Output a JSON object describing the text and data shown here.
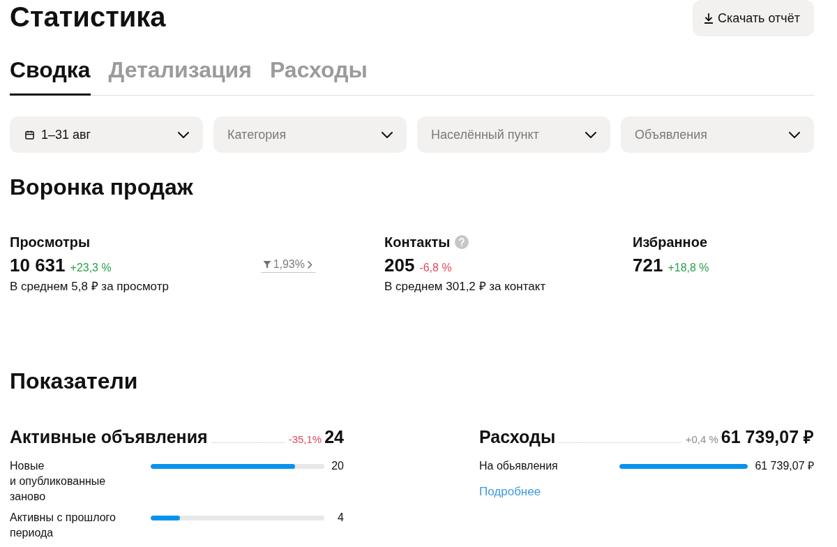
{
  "page": {
    "title": "Статистика",
    "download_button": "Скачать отчёт"
  },
  "tabs": [
    {
      "label": "Сводка",
      "selected": true
    },
    {
      "label": "Детализация",
      "selected": false
    },
    {
      "label": "Расходы",
      "selected": false
    }
  ],
  "filters": [
    {
      "kind": "date",
      "value": "1–31 авг"
    },
    {
      "kind": "select",
      "placeholder": "Категория"
    },
    {
      "kind": "select",
      "placeholder": "Населённый пункт"
    },
    {
      "kind": "select",
      "placeholder": "Объявления"
    }
  ],
  "sales_funnel": {
    "title": "Воронка продаж",
    "metrics": [
      {
        "label": "Просмотры",
        "value": "10 631",
        "change": "+23,3 %",
        "color": "#26a348",
        "conversion": "1,93%",
        "note": "В среднем 5,8 ₽ за просмотр"
      },
      {
        "label": "Контакты",
        "help": true,
        "value": "205",
        "change": "-6,8 %",
        "color": "#e2475c",
        "note": "В среднем 301,2 ₽ за контакт"
      },
      {
        "label": "Избранное",
        "value": "721",
        "change": "+18,8 %",
        "color": "#26a348"
      }
    ]
  },
  "indicators": {
    "title": "Показатели",
    "panels": [
      {
        "title": "Активные объявления",
        "change": "-35,1%",
        "color": "#e2475c",
        "total": "24",
        "rows": [
          {
            "label": "Новые и опубликованные заново",
            "level": 0.83,
            "value": "20"
          },
          {
            "label": "Активны с прошлого периода",
            "level": 0.17,
            "value": "4"
          }
        ]
      },
      {
        "title": "Расходы",
        "change": "+0,4 %",
        "color": "#8c8c8c",
        "total": "61 739,07 ₽",
        "rows": [
          {
            "label": "На обьявления",
            "level": 1,
            "value": "61 739,07 ₽"
          }
        ],
        "link": "Подробнее"
      }
    ]
  }
}
